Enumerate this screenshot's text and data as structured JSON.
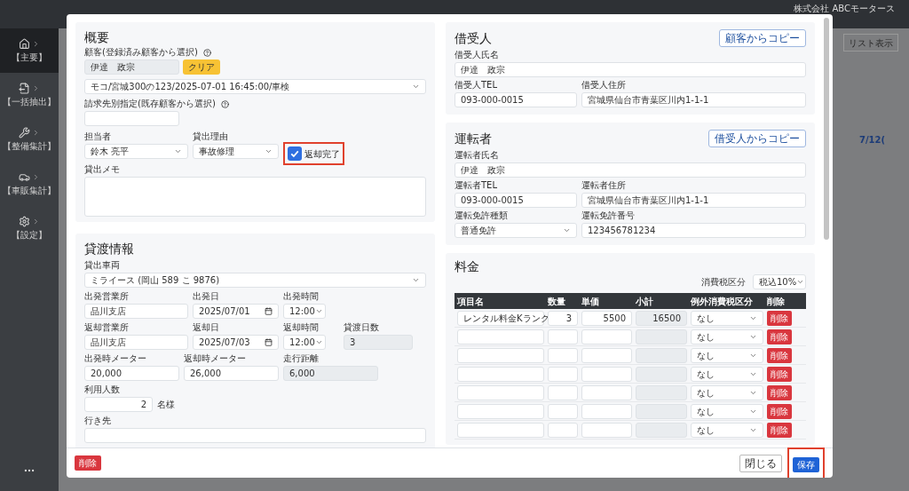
{
  "topbar": {
    "company": "株式会社 ABCモータース"
  },
  "sidebar": {
    "items": [
      {
        "label": "【主要】",
        "selected": true
      },
      {
        "label": "【一括抽出】",
        "selected": false
      },
      {
        "label": "【整備集計】",
        "selected": false
      },
      {
        "label": "【車販集計】",
        "selected": false
      },
      {
        "label": "【設定】",
        "selected": false
      }
    ]
  },
  "background": {
    "view_button": "リスト表示",
    "date_heading": "7/12("
  },
  "modal": {
    "overview": {
      "title": "概要",
      "customer": {
        "label": "顧客(登録済み顧客から選択)",
        "value": "伊達　政宗",
        "clear_button": "クリア"
      },
      "vehicle_select": "モコ/宮城300の123/2025-07-01 16:45:00/車検",
      "billing": {
        "label": "請求先別指定(既存顧客から選択)"
      },
      "staff": {
        "label": "担当者",
        "value": "鈴木 亮平"
      },
      "reason": {
        "label": "貸出理由",
        "value": "事故修理"
      },
      "returned": {
        "label": "返却完了",
        "checked": true,
        "highlighted": true
      },
      "memo": {
        "label": "貸出メモ"
      }
    },
    "rental": {
      "title": "貸渡情報",
      "vehicle": {
        "label": "貸出車両",
        "value": "ミライース (岡山 589 こ 9876)"
      },
      "rows": [
        [
          {
            "label": "出発営業所",
            "value": "品川支店",
            "kind": "text"
          },
          {
            "label": "出発日",
            "value": "2025/07/01",
            "kind": "date"
          },
          {
            "label": "出発時間",
            "value": "12:00",
            "kind": "select"
          }
        ],
        [
          {
            "label": "返却営業所",
            "value": "品川支店",
            "kind": "text"
          },
          {
            "label": "返却日",
            "value": "2025/07/03",
            "kind": "date"
          },
          {
            "label": "返却時間",
            "value": "12:00",
            "kind": "select"
          },
          {
            "label": "貸渡日数",
            "value": "3",
            "kind": "readonly"
          }
        ],
        [
          {
            "label": "出発時メーター",
            "value": "20,000",
            "kind": "text"
          },
          {
            "label": "返却時メーター",
            "value": "26,000",
            "kind": "text"
          },
          {
            "label": "走行距離",
            "value": "6,000",
            "kind": "readonly"
          }
        ]
      ],
      "people": {
        "label": "利用人数",
        "value": "2",
        "unit": "名様"
      },
      "destination": {
        "label": "行き先"
      }
    },
    "borrower": {
      "title": "借受人",
      "copy_button": "顧客からコピー",
      "name": {
        "label": "借受人氏名",
        "value": "伊達　政宗"
      },
      "tel": {
        "label": "借受人TEL",
        "value": "093-000-0015"
      },
      "address": {
        "label": "借受人住所",
        "value": "宮城県仙台市青葉区川内1-1-1"
      }
    },
    "driver": {
      "title": "運転者",
      "copy_button": "借受人からコピー",
      "name": {
        "label": "運転者氏名",
        "value": "伊達　政宗"
      },
      "tel": {
        "label": "運転者TEL",
        "value": "093-000-0015"
      },
      "address": {
        "label": "運転者住所",
        "value": "宮城県仙台市青葉区川内1-1-1"
      },
      "license_type": {
        "label": "運転免許種類",
        "value": "普通免許"
      },
      "license_number": {
        "label": "運転免許番号",
        "value": "123456781234"
      }
    },
    "fees": {
      "title": "料金",
      "tax_label": "消費税区分",
      "tax_value": "税込10%",
      "columns": [
        "項目名",
        "数量",
        "単価",
        "小計",
        "例外消費税区分",
        "削除"
      ],
      "rows": [
        {
          "name": "レンタル料金Kランク",
          "qty": "3",
          "price": "5500",
          "subtotal": "16500",
          "tax": "なし",
          "delete": "削除"
        },
        {
          "tax": "なし",
          "delete": "削除"
        },
        {
          "tax": "なし",
          "delete": "削除"
        },
        {
          "tax": "なし",
          "delete": "削除"
        },
        {
          "tax": "なし",
          "delete": "削除"
        },
        {
          "tax": "なし",
          "delete": "削除"
        },
        {
          "tax": "なし",
          "delete": "削除"
        }
      ]
    },
    "footer": {
      "delete": "削除",
      "close": "閉じる",
      "save": "保存",
      "save_highlighted": true
    }
  }
}
